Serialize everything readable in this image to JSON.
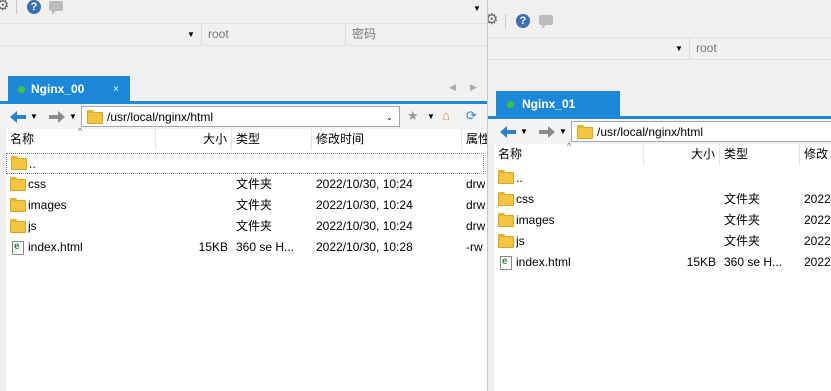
{
  "left_window": {
    "top_fields": {
      "user": "root",
      "password": "密码"
    },
    "tab": {
      "label": "Nginx_00",
      "close": "×"
    },
    "tab_scroll": {
      "prev": "◀",
      "next": "▶"
    },
    "path": "/usr/local/nginx/html",
    "columns": [
      "名称",
      "大小",
      "类型",
      "修改时间",
      "属性"
    ],
    "files": [
      {
        "name": "..",
        "size": "",
        "type": "",
        "mtime": "",
        "attr": "",
        "icon": "folder-icon"
      },
      {
        "name": "css",
        "size": "",
        "type": "文件夹",
        "mtime": "2022/10/30, 10:24",
        "attr": "drw",
        "icon": "folder-icon"
      },
      {
        "name": "images",
        "size": "",
        "type": "文件夹",
        "mtime": "2022/10/30, 10:24",
        "attr": "drw",
        "icon": "folder-icon"
      },
      {
        "name": "js",
        "size": "",
        "type": "文件夹",
        "mtime": "2022/10/30, 10:24",
        "attr": "drw",
        "icon": "folder-icon"
      },
      {
        "name": "index.html",
        "size": "15KB",
        "type": "360 se H...",
        "mtime": "2022/10/30, 10:28",
        "attr": "-rw",
        "icon": "html-file-icon"
      }
    ]
  },
  "right_window": {
    "top_fields": {
      "user": "root"
    },
    "tab": {
      "label": "Nginx_01"
    },
    "path": "/usr/local/nginx/html",
    "columns": [
      "名称",
      "大小",
      "类型",
      "修改"
    ],
    "files": [
      {
        "name": "..",
        "size": "",
        "type": "",
        "mtime": "",
        "icon": "folder-icon"
      },
      {
        "name": "css",
        "size": "",
        "type": "文件夹",
        "mtime": "2022",
        "icon": "folder-icon"
      },
      {
        "name": "images",
        "size": "",
        "type": "文件夹",
        "mtime": "2022",
        "icon": "folder-icon"
      },
      {
        "name": "js",
        "size": "",
        "type": "文件夹",
        "mtime": "2022",
        "icon": "folder-icon"
      },
      {
        "name": "index.html",
        "size": "15KB",
        "type": "360 se H...",
        "mtime": "2022",
        "icon": "html-file-icon"
      }
    ]
  },
  "colors": {
    "tab_accent": "#1e88d8",
    "connected_dot": "#3ec43e",
    "folder": "#f5c542"
  }
}
